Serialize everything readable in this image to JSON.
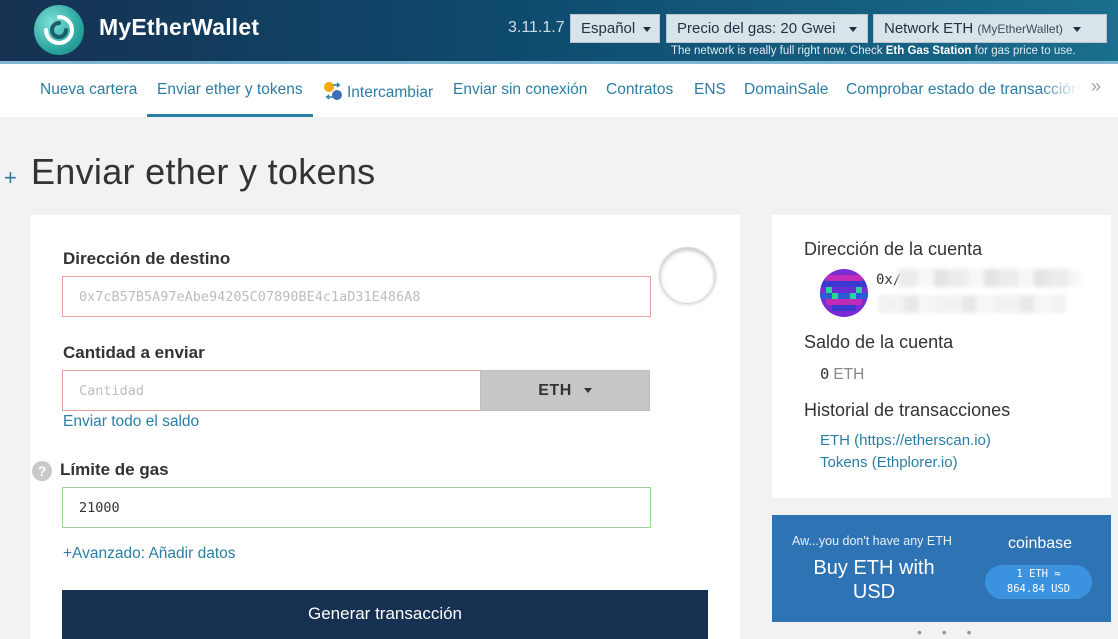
{
  "header": {
    "brand": "MyEtherWallet",
    "version": "3.11.1.7",
    "language": "Español",
    "gas_price": "Precio del gas: 20 Gwei",
    "network_label": "Network ETH",
    "network_sub": "(MyEtherWallet)",
    "gas_note_pre": "The network is really full right now. Check ",
    "gas_note_link": "Eth Gas Station",
    "gas_note_post": " for gas price to use."
  },
  "nav": {
    "items": [
      "Nueva cartera",
      "Enviar ether y tokens",
      "Intercambiar",
      "Enviar sin conexión",
      "Contratos",
      "ENS",
      "DomainSale",
      "Comprobar estado de transacción"
    ],
    "active": "Enviar ether y tokens",
    "more": "»"
  },
  "page": {
    "plus": "+",
    "title": "Enviar ether y tokens"
  },
  "form": {
    "to_label": "Dirección de destino",
    "to_placeholder": "0x7cB57B5A97eAbe94205C07890BE4c1aD31E486A8",
    "amount_label": "Cantidad a enviar",
    "amount_placeholder": "Cantidad",
    "unit": "ETH",
    "send_all": "Enviar todo el saldo",
    "gas_label": "Límite de gas",
    "gas_value": "21000",
    "advanced": "+Avanzado: Añadir datos",
    "generate": "Generar transacción",
    "help": "?"
  },
  "account": {
    "address_label": "Dirección de la cuenta",
    "address_prefix": "0x/",
    "balance_label": "Saldo de la cuenta",
    "balance_value": "0",
    "balance_unit": "ETH",
    "history_label": "Historial de transacciones",
    "history_links": [
      "ETH (https://etherscan.io)",
      "Tokens (Ethplorer.io)"
    ]
  },
  "promo": {
    "small": "Aw...you don't have any ETH",
    "big": "Buy ETH with USD",
    "brand": "coinbase",
    "rate_line1": "1 ETH ≈",
    "rate_line2": "864.84 USD",
    "dots": "• • •"
  },
  "colors": {
    "header_dark": "#163151",
    "link": "#2b7ea3",
    "promo": "#2e74b5",
    "invalid_border": "#e9a39f",
    "valid_border": "#9fd29b"
  }
}
